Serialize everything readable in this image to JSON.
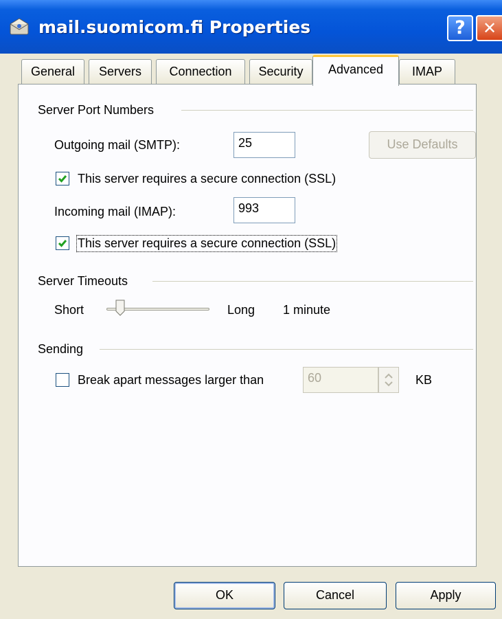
{
  "window": {
    "title": "mail.suomicom.fi Properties",
    "help_glyph": "?",
    "close_glyph": "✕"
  },
  "tabs": [
    {
      "label": "General",
      "active": false
    },
    {
      "label": "Servers",
      "active": false
    },
    {
      "label": "Connection",
      "active": false
    },
    {
      "label": "Security",
      "active": false
    },
    {
      "label": "Advanced",
      "active": true
    },
    {
      "label": "IMAP",
      "active": false
    }
  ],
  "ports": {
    "group_title": "Server Port Numbers",
    "outgoing_label": "Outgoing mail (SMTP):",
    "outgoing_value": "25",
    "use_defaults_label": "Use Defaults",
    "outgoing_ssl_label": "This server requires a secure connection (SSL)",
    "outgoing_ssl_checked": true,
    "incoming_label": "Incoming mail (IMAP):",
    "incoming_value": "993",
    "incoming_ssl_label": "This server requires a secure connection (SSL)",
    "incoming_ssl_checked": true
  },
  "timeouts": {
    "group_title": "Server Timeouts",
    "short_label": "Short",
    "long_label": "Long",
    "value_text": "1 minute"
  },
  "sending": {
    "group_title": "Sending",
    "break_label": "Break apart messages larger than",
    "break_checked": false,
    "size_value": "60",
    "unit_label": "KB"
  },
  "buttons": {
    "ok": "OK",
    "cancel": "Cancel",
    "apply": "Apply"
  },
  "colors": {
    "titlebar": "#0454d8",
    "dialog_bg": "#ece9d8",
    "active_tab_accent": "#ffc83c",
    "check": "#21a121"
  }
}
